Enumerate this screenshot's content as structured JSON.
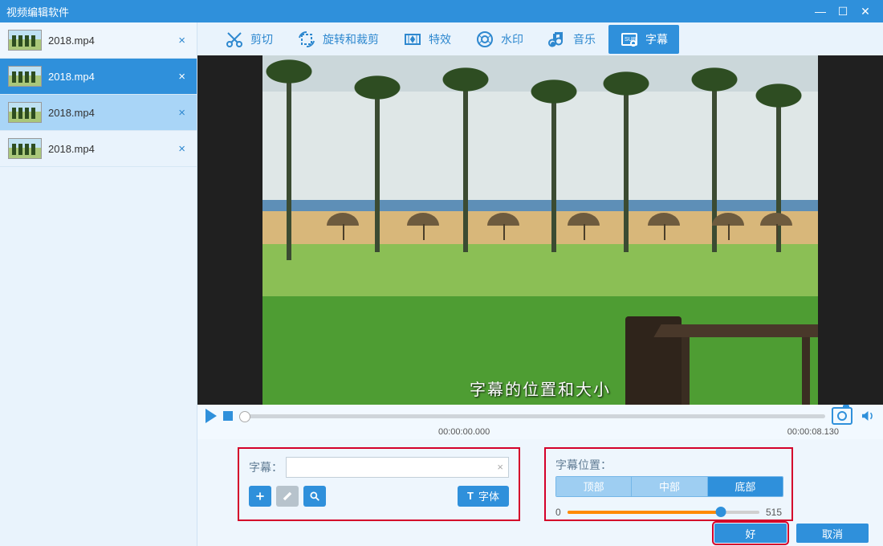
{
  "window": {
    "title": "视频编辑软件"
  },
  "sidebar": {
    "files": [
      {
        "name": "2018.mp4",
        "state": "active-normal"
      },
      {
        "name": "2018.mp4",
        "state": "sel-dark"
      },
      {
        "name": "2018.mp4",
        "state": "sel-light"
      },
      {
        "name": "2018.mp4",
        "state": ""
      }
    ]
  },
  "toolbar": {
    "items": [
      {
        "id": "cut",
        "label": "剪切",
        "icon": "scissors-icon"
      },
      {
        "id": "rotate",
        "label": "旋转和裁剪",
        "icon": "rotate-crop-icon"
      },
      {
        "id": "effects",
        "label": "特效",
        "icon": "effects-icon"
      },
      {
        "id": "watermark",
        "label": "水印",
        "icon": "watermark-icon"
      },
      {
        "id": "music",
        "label": "音乐",
        "icon": "music-icon"
      },
      {
        "id": "subtitle",
        "label": "字幕",
        "icon": "subtitle-icon",
        "active": true
      }
    ]
  },
  "preview": {
    "subtitle_overlay": "字幕的位置和大小"
  },
  "transport": {
    "time_start": "00:00:00.000",
    "time_end": "00:00:08.130"
  },
  "subtitle_panel": {
    "label": "字幕：",
    "input_value": "",
    "font_btn": "字体"
  },
  "position_panel": {
    "label": "字幕位置：",
    "segments": {
      "top": "顶部",
      "middle": "中部",
      "bottom": "底部"
    },
    "active": "bottom",
    "slider_min": "0",
    "slider_value": "515"
  },
  "footer": {
    "ok": "好",
    "cancel": "取消"
  }
}
